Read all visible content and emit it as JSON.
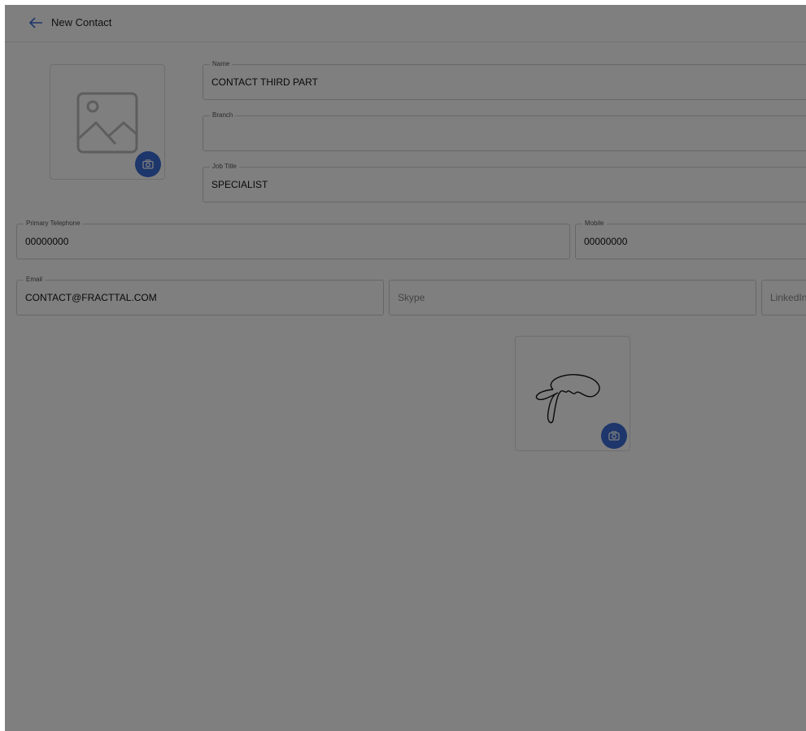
{
  "header": {
    "title": "New Contact"
  },
  "form": {
    "name": {
      "label": "Name",
      "value": "CONTACT THIRD PART"
    },
    "branch": {
      "label": "Branch",
      "value": ""
    },
    "job_title": {
      "label": "Job Title",
      "value": "SPECIALIST"
    },
    "primary_telephone": {
      "label": "Primary Telephone",
      "value": "00000000"
    },
    "mobile": {
      "label": "Mobile",
      "value": "00000000"
    },
    "email": {
      "label": "Email",
      "value": "CONTACT@FRACTTAL.COM"
    },
    "skype": {
      "placeholder": "Skype"
    },
    "linkedin": {
      "placeholder": "LinkedIn"
    }
  },
  "icons": {
    "back": "arrow-left-icon",
    "photo_placeholder": "image-icon",
    "camera": "camera-icon"
  },
  "colors": {
    "accent": "#3a6cd6",
    "overlay": "rgba(0,0,0,0.5)"
  }
}
